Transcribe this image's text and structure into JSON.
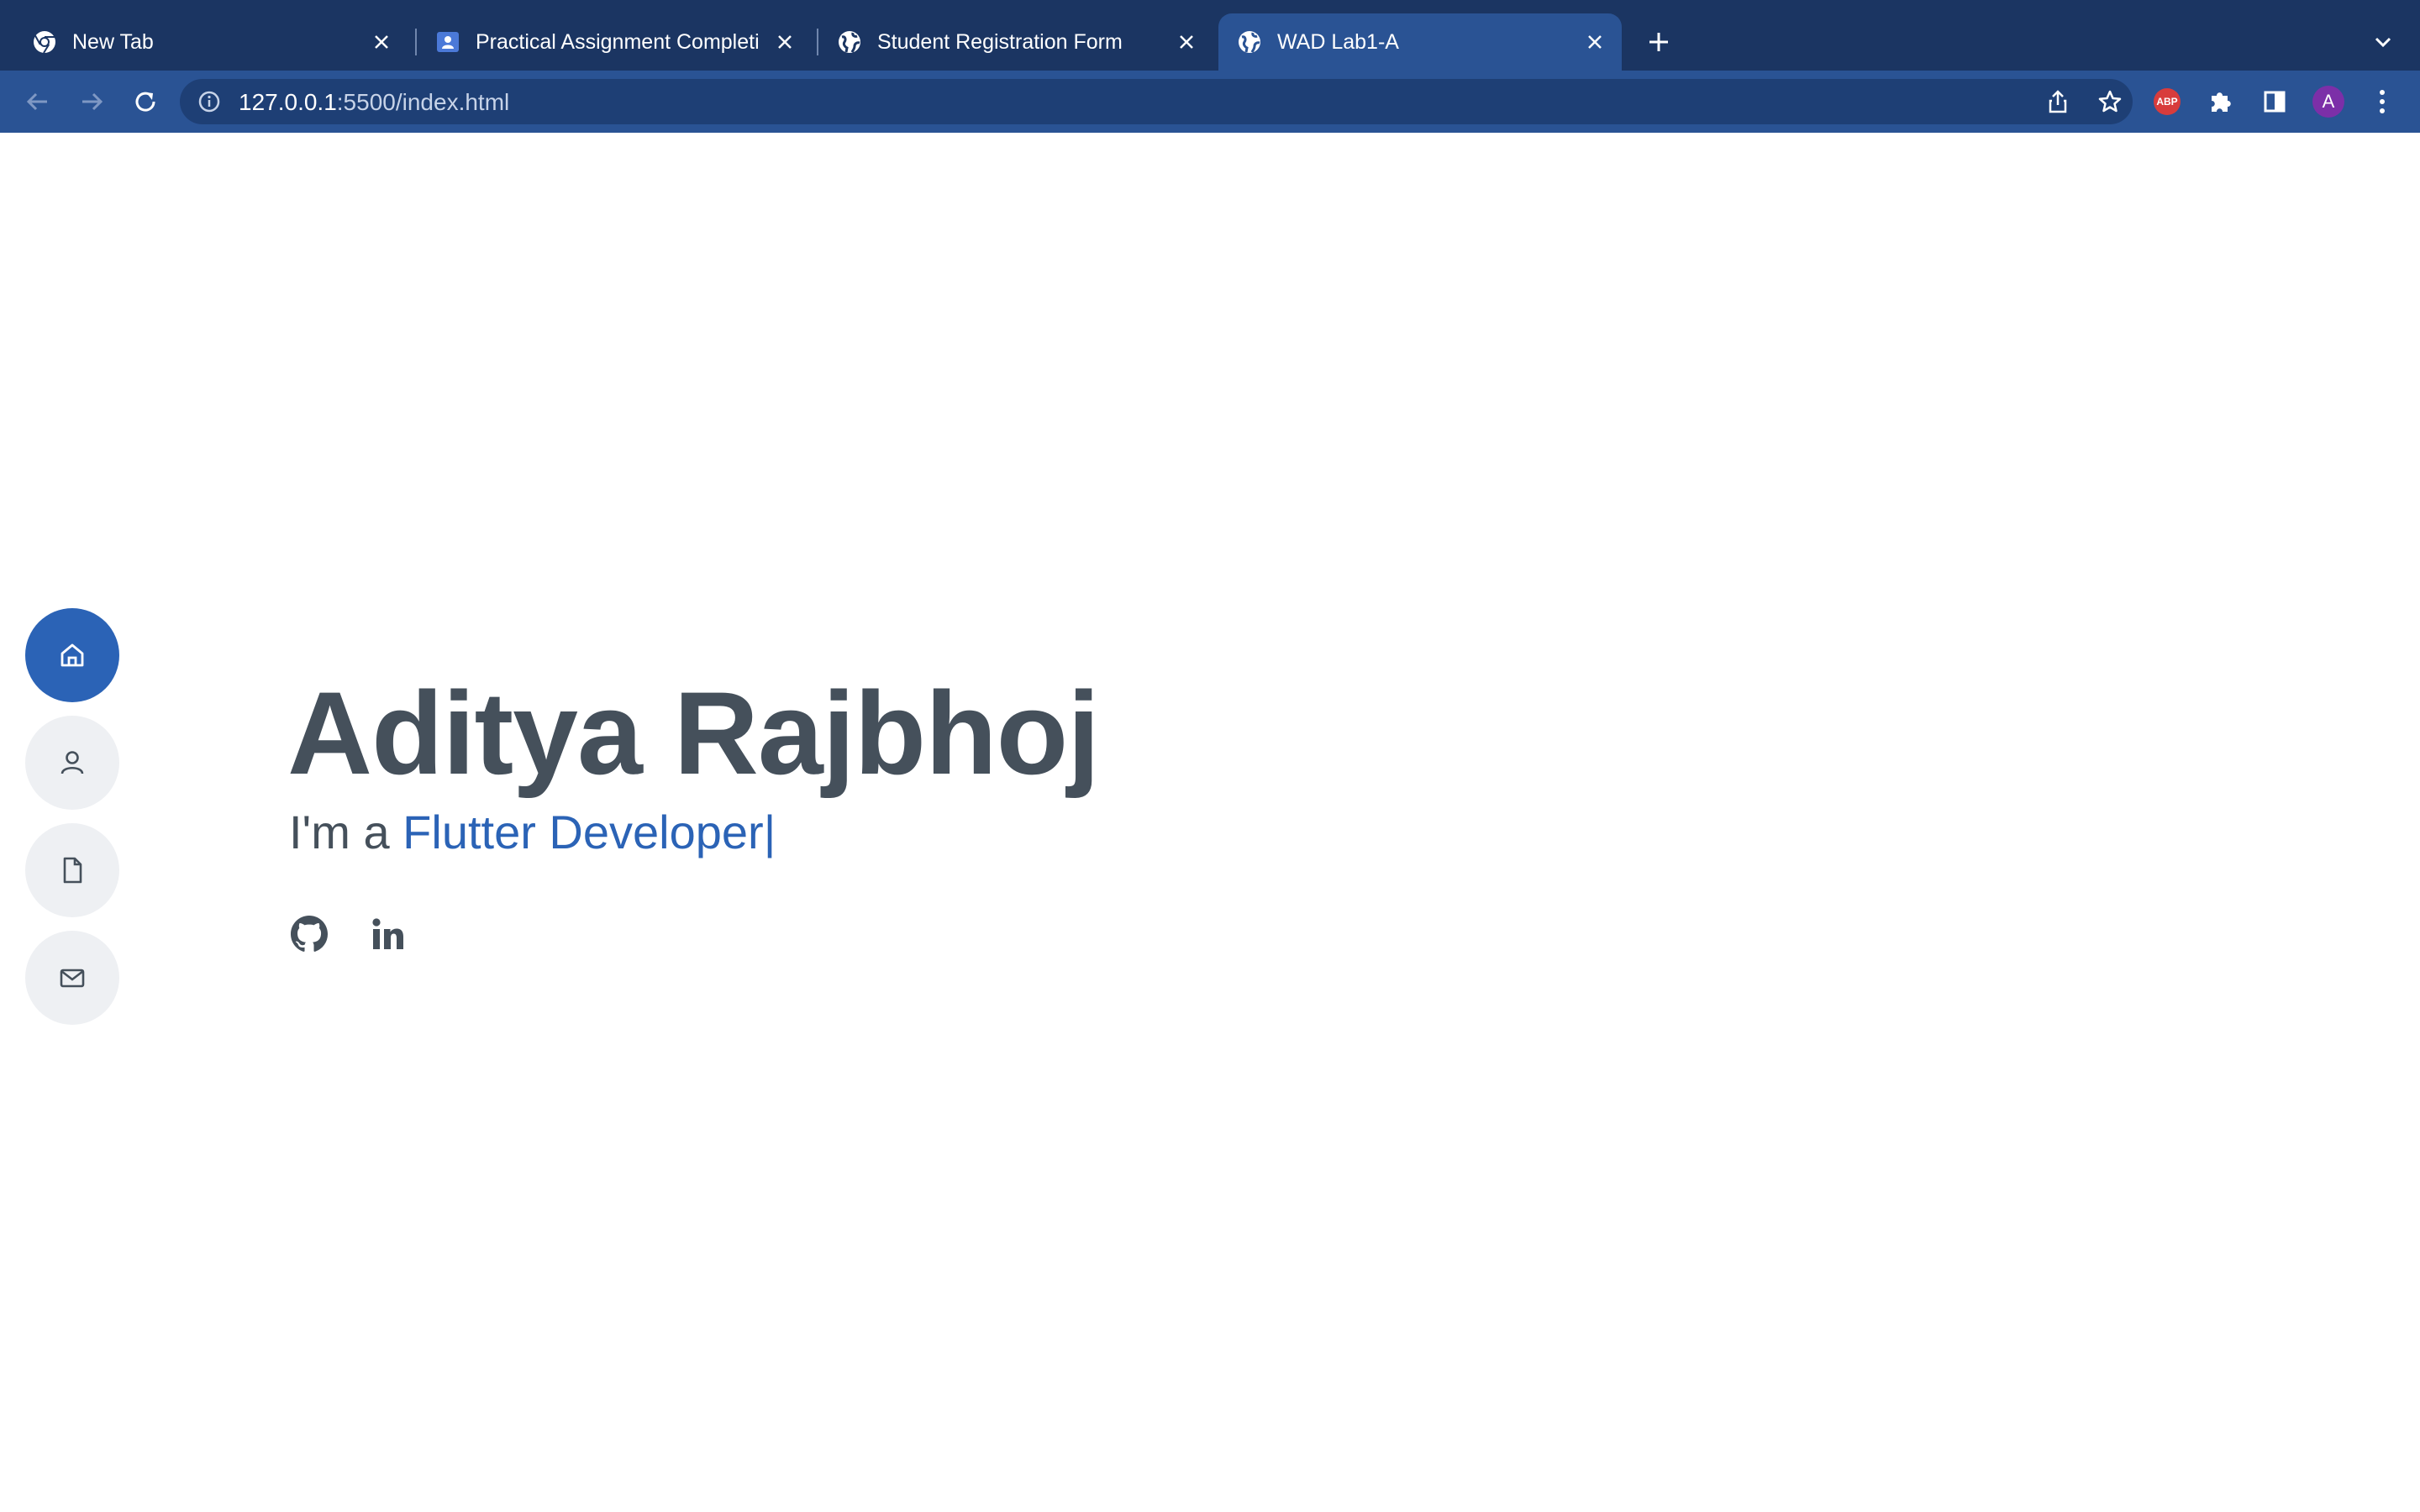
{
  "browser": {
    "tabs": [
      {
        "title": "New Tab",
        "favicon": "chrome-icon",
        "active": false
      },
      {
        "title": "Practical Assignment Completi",
        "favicon": "classroom-icon",
        "active": false
      },
      {
        "title": "Student Registration Form",
        "favicon": "globe-icon",
        "active": false
      },
      {
        "title": "WAD Lab1-A",
        "favicon": "globe-icon",
        "active": true
      }
    ],
    "url_host": "127.0.0.1",
    "url_rest": ":5500/index.html",
    "extensions": {
      "abp_label": "ABP",
      "profile_initial": "A"
    },
    "colors": {
      "tabstrip": "#1b3562",
      "toolbar": "#2a5394",
      "omnibox": "#1e3f75"
    }
  },
  "page": {
    "sidenav": [
      {
        "icon": "home-icon",
        "active": true
      },
      {
        "icon": "user-icon",
        "active": false
      },
      {
        "icon": "file-icon",
        "active": false
      },
      {
        "icon": "mail-icon",
        "active": false
      }
    ],
    "hero": {
      "name": "Aditya Rajbhoj",
      "prefix": "I'm a",
      "typed": "Flutter Developer",
      "cursor": "|"
    },
    "social": [
      "github-icon",
      "linkedin-icon"
    ],
    "colors": {
      "accent": "#2b63b6",
      "text": "#45505b",
      "nav_bg": "#eef0f3"
    }
  }
}
